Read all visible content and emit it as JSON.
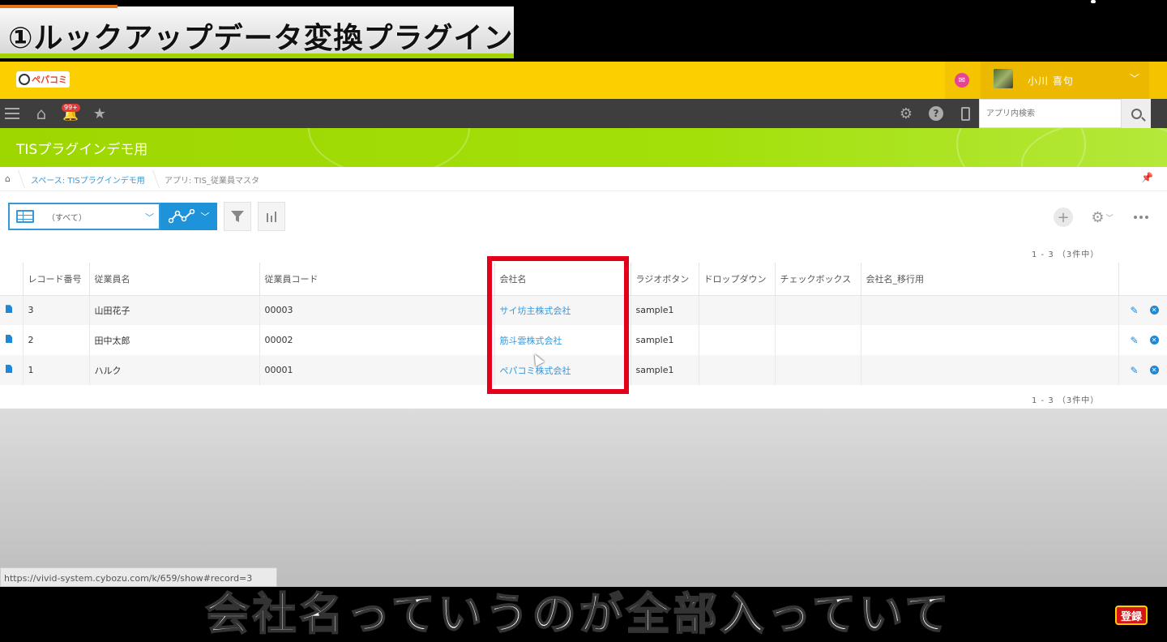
{
  "video": {
    "title_banner": "①ルックアップデータ変換プラグイン",
    "subtitle": "会社名っていうのが全部入っていて",
    "subscribe_label": "登録"
  },
  "header": {
    "logo_text": "ペパコミ",
    "user_name": "小川 喜句",
    "notification_count": "99+",
    "search_placeholder": "アプリ内検索"
  },
  "space": {
    "title": "TISプラグインデモ用"
  },
  "breadcrumb": {
    "space": "スペース: TISプラグインデモ用",
    "app": "アプリ: TIS_従業員マスタ"
  },
  "toolbar": {
    "view_label": "（すべて）"
  },
  "pager": {
    "top": "1 - 3 （3件中）",
    "bottom": "1 - 3 （3件中）"
  },
  "table": {
    "headers": [
      "レコード番号",
      "従業員名",
      "従業員コード",
      "会社名",
      "ラジオボタン",
      "ドロップダウン",
      "チェックボックス",
      "会社名_移行用"
    ],
    "rows": [
      {
        "record_no": "3",
        "name": "山田花子",
        "code": "00003",
        "company": "サイ坊主株式会社",
        "radio": "sample1",
        "dropdown": "",
        "checkbox": "",
        "company_migration": ""
      },
      {
        "record_no": "2",
        "name": "田中太郎",
        "code": "00002",
        "company": "筋斗雲株式会社",
        "radio": "sample1",
        "dropdown": "",
        "checkbox": "",
        "company_migration": ""
      },
      {
        "record_no": "1",
        "name": "ハルク",
        "code": "00001",
        "company": "ペパコミ株式会社",
        "radio": "sample1",
        "dropdown": "",
        "checkbox": "",
        "company_migration": ""
      }
    ]
  },
  "status_bar": {
    "url": "https://vivid-system.cybozu.com/k/659/show#record=3"
  },
  "colors": {
    "header_yellow": "#fccf00",
    "space_green": "#9ed600",
    "accent_blue": "#1e93d9",
    "highlight_red": "#e4001b"
  }
}
